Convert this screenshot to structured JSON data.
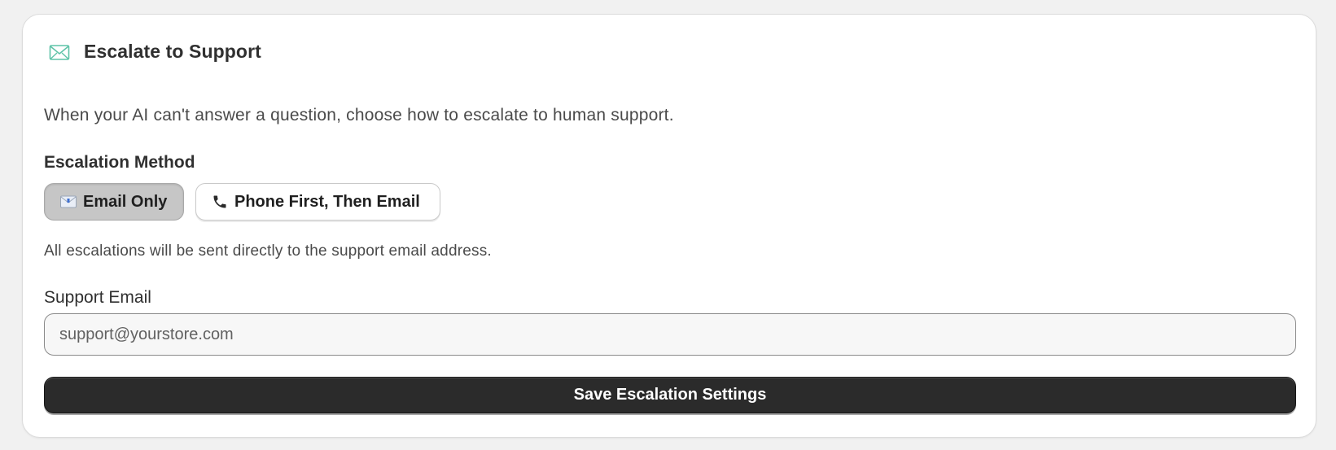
{
  "card": {
    "title": "Escalate to Support",
    "icon": "envelope-icon",
    "description": "When your AI can't answer a question, choose how to escalate to human support."
  },
  "escalation": {
    "label": "Escalation Method",
    "options": [
      {
        "icon": "envelope-icon",
        "label": "Email Only",
        "selected": true
      },
      {
        "icon": "phone-icon",
        "label": "Phone First, Then Email",
        "selected": false
      }
    ],
    "hint": "All escalations will be sent directly to the support email address."
  },
  "support_email": {
    "label": "Support Email",
    "placeholder": "support@yourstore.com",
    "value": ""
  },
  "save": {
    "label": "Save Escalation Settings"
  },
  "colors": {
    "accent_icon": "#5fc3a8",
    "primary_button": "#2b2b2b",
    "selected_option": "#c6c6c6"
  }
}
